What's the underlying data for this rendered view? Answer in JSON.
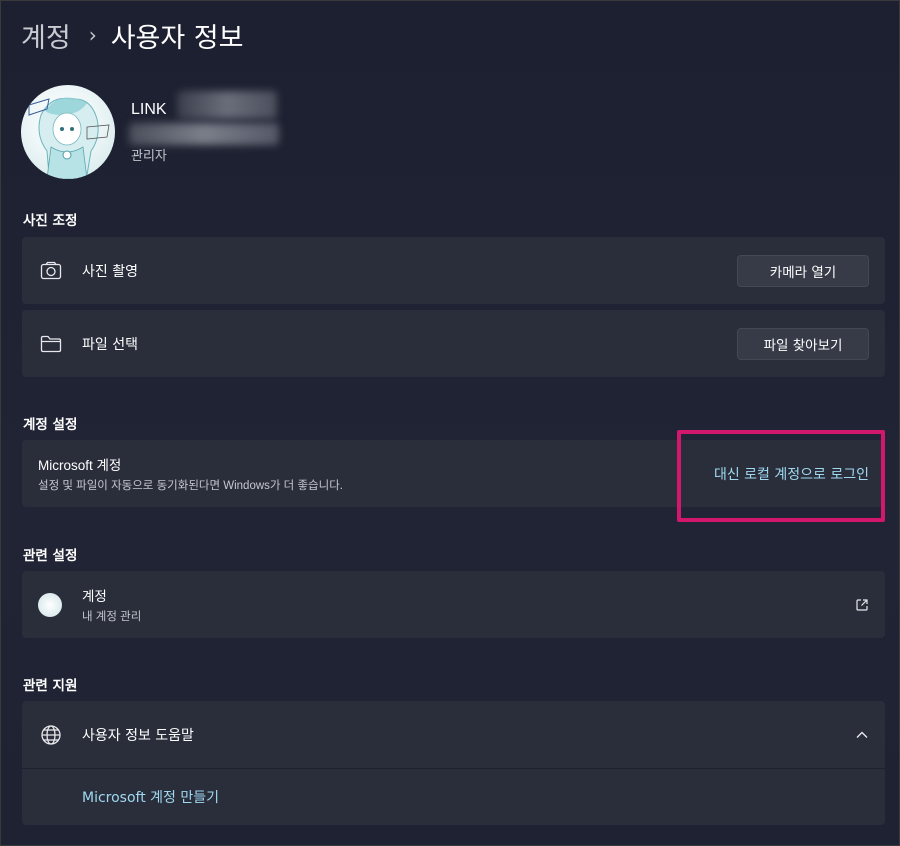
{
  "header": {
    "breadcrumb_parent": "계정",
    "breadcrumb_separator": "›",
    "page_title": "사용자 정보"
  },
  "profile": {
    "name": "LINK",
    "role": "관리자"
  },
  "photo_section": {
    "title": "사진 조정",
    "items": [
      {
        "label": "사진 촬영",
        "icon": "camera-icon",
        "button": "카메라 열기"
      },
      {
        "label": "파일 선택",
        "icon": "folder-icon",
        "button": "파일 찾아보기"
      }
    ]
  },
  "account_settings": {
    "title": "계정 설정",
    "ms_title": "Microsoft 계정",
    "ms_desc": "설정 및 파일이 자동으로 동기화된다면 Windows가 더 좋습니다.",
    "link": "대신 로컬 계정으로 로그인",
    "highlight_color": "#d3176e"
  },
  "related_settings": {
    "title": "관련 설정",
    "item_title": "계정",
    "item_desc": "내 계정 관리",
    "icon": "external-link-icon"
  },
  "related_support": {
    "title": "관련 지원",
    "item_label": "사용자 정보 도움말",
    "icon": "globe-icon",
    "expand_icon": "chevron-up-icon",
    "sub_link": "Microsoft 계정 만들기"
  }
}
